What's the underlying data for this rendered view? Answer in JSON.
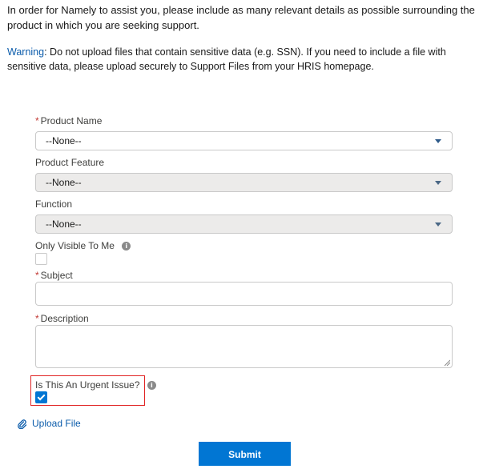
{
  "intro": {
    "text": "In order for Namely to assist you, please include as many relevant details as possible surrounding the product in which you are seeking support."
  },
  "warning": {
    "label": "Warning",
    "text": ": Do not upload files that contain sensitive data (e.g. SSN). If you need to include a file with sensitive data, please upload securely to Support Files from your HRIS homepage."
  },
  "form": {
    "required_marker": "*",
    "product_name": {
      "label": "Product Name",
      "value": "--None--"
    },
    "product_feature": {
      "label": "Product Feature",
      "value": "--None--"
    },
    "function": {
      "label": "Function",
      "value": "--None--"
    },
    "only_visible": {
      "label": "Only Visible To Me",
      "checked": false
    },
    "subject": {
      "label": "Subject",
      "value": ""
    },
    "description": {
      "label": "Description",
      "value": ""
    },
    "urgent": {
      "label": "Is This An Urgent Issue?",
      "checked": true
    },
    "upload_label": "Upload File",
    "submit_label": "Submit"
  },
  "colors": {
    "accent": "#0176d3",
    "link": "#0b5cab",
    "required": "#c23934",
    "highlight": "#e02424"
  }
}
